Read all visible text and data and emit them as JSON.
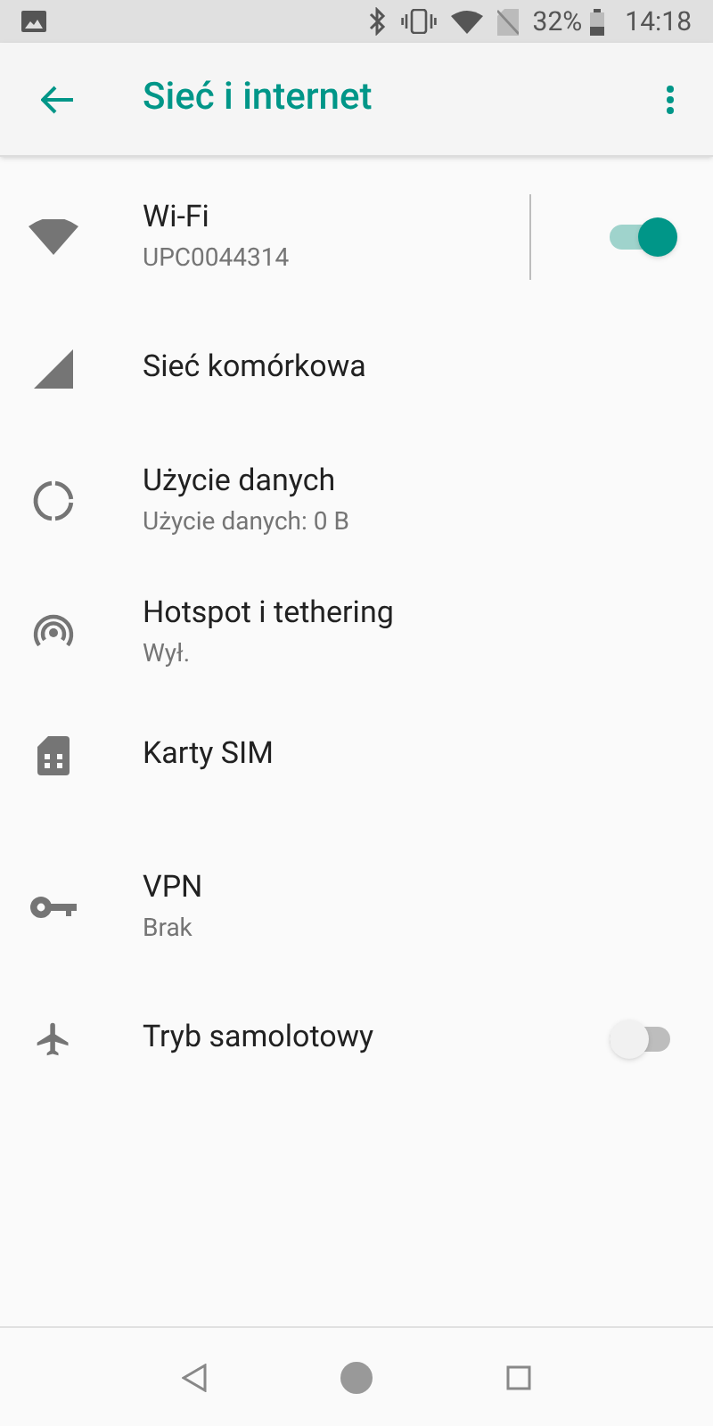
{
  "status_bar": {
    "battery": "32%",
    "time": "14:18"
  },
  "app_bar": {
    "title": "Sieć i internet"
  },
  "items": [
    {
      "kind": "wifi",
      "title": "Wi-Fi",
      "subtitle": "UPC0044314",
      "on": true
    },
    {
      "kind": "signal",
      "title": "Sieć komórkowa"
    },
    {
      "kind": "data",
      "title": "Użycie danych",
      "subtitle": "Użycie danych: 0 B"
    },
    {
      "kind": "hotspot",
      "title": "Hotspot i tethering",
      "subtitle": "Wył."
    },
    {
      "kind": "sim",
      "title": "Karty SIM"
    },
    {
      "kind": "key",
      "title": "VPN",
      "subtitle": "Brak"
    },
    {
      "kind": "plane",
      "title": "Tryb samolotowy",
      "on": false
    }
  ]
}
